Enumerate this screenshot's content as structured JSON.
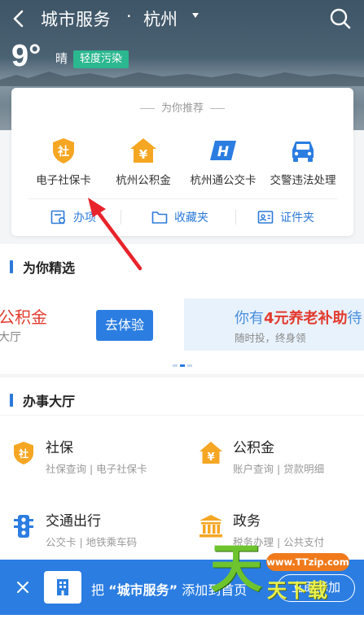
{
  "header": {
    "title": "城市服务",
    "separator": "·",
    "city": "杭州",
    "temperature": "9°",
    "weather": "晴",
    "air_quality": "轻度污染"
  },
  "recommend": {
    "title": "为你推荐",
    "services": [
      {
        "label": "电子社保卡",
        "icon": "social-security-shield-icon",
        "glyph": "社"
      },
      {
        "label": "杭州公积金",
        "icon": "housing-fund-house-icon",
        "glyph": "¥"
      },
      {
        "label": "杭州通公交卡",
        "icon": "bus-card-icon",
        "glyph": "H"
      },
      {
        "label": "交警违法处理",
        "icon": "car-icon"
      }
    ],
    "actions": [
      {
        "label": "办项",
        "icon": "task-list-icon"
      },
      {
        "label": "收藏夹",
        "icon": "folder-icon"
      },
      {
        "label": "证件夹",
        "icon": "id-card-icon"
      }
    ]
  },
  "featured": {
    "title": "为你精选",
    "banner_left": {
      "title": "公积金",
      "subtitle": "大厅",
      "button": "去体验"
    },
    "banner_right": {
      "title_pre": "你有",
      "title_highlight": "4元养老补助",
      "title_post": "待",
      "subtitle": "随时投，终身领"
    }
  },
  "hall": {
    "title": "办事大厅",
    "items": [
      {
        "title": "社保",
        "subtitle": "社保查询 | 电子社保卡",
        "icon": "social-security-icon",
        "glyph": "社"
      },
      {
        "title": "公积金",
        "subtitle": "账户查询 | 贷款明细",
        "icon": "housing-fund-icon",
        "glyph": "¥"
      },
      {
        "title": "交通出行",
        "subtitle": "公交卡 | 地铁乘车码",
        "icon": "traffic-light-icon"
      },
      {
        "title": "政务",
        "subtitle": "税务办理 | 公共支付",
        "icon": "government-building-icon"
      }
    ]
  },
  "add_banner": {
    "prefix": "把 ",
    "quoted": "“城市服务”",
    "suffix": " 添加到首页",
    "button": "立即添加"
  },
  "watermark": {
    "url": "www.TTzip.com",
    "big": "天",
    "small": "天下载"
  },
  "colors": {
    "accent": "#2b7de1",
    "shield": "#f5a623",
    "aqi": "#2bb78f",
    "highlight": "#e23a2d"
  }
}
